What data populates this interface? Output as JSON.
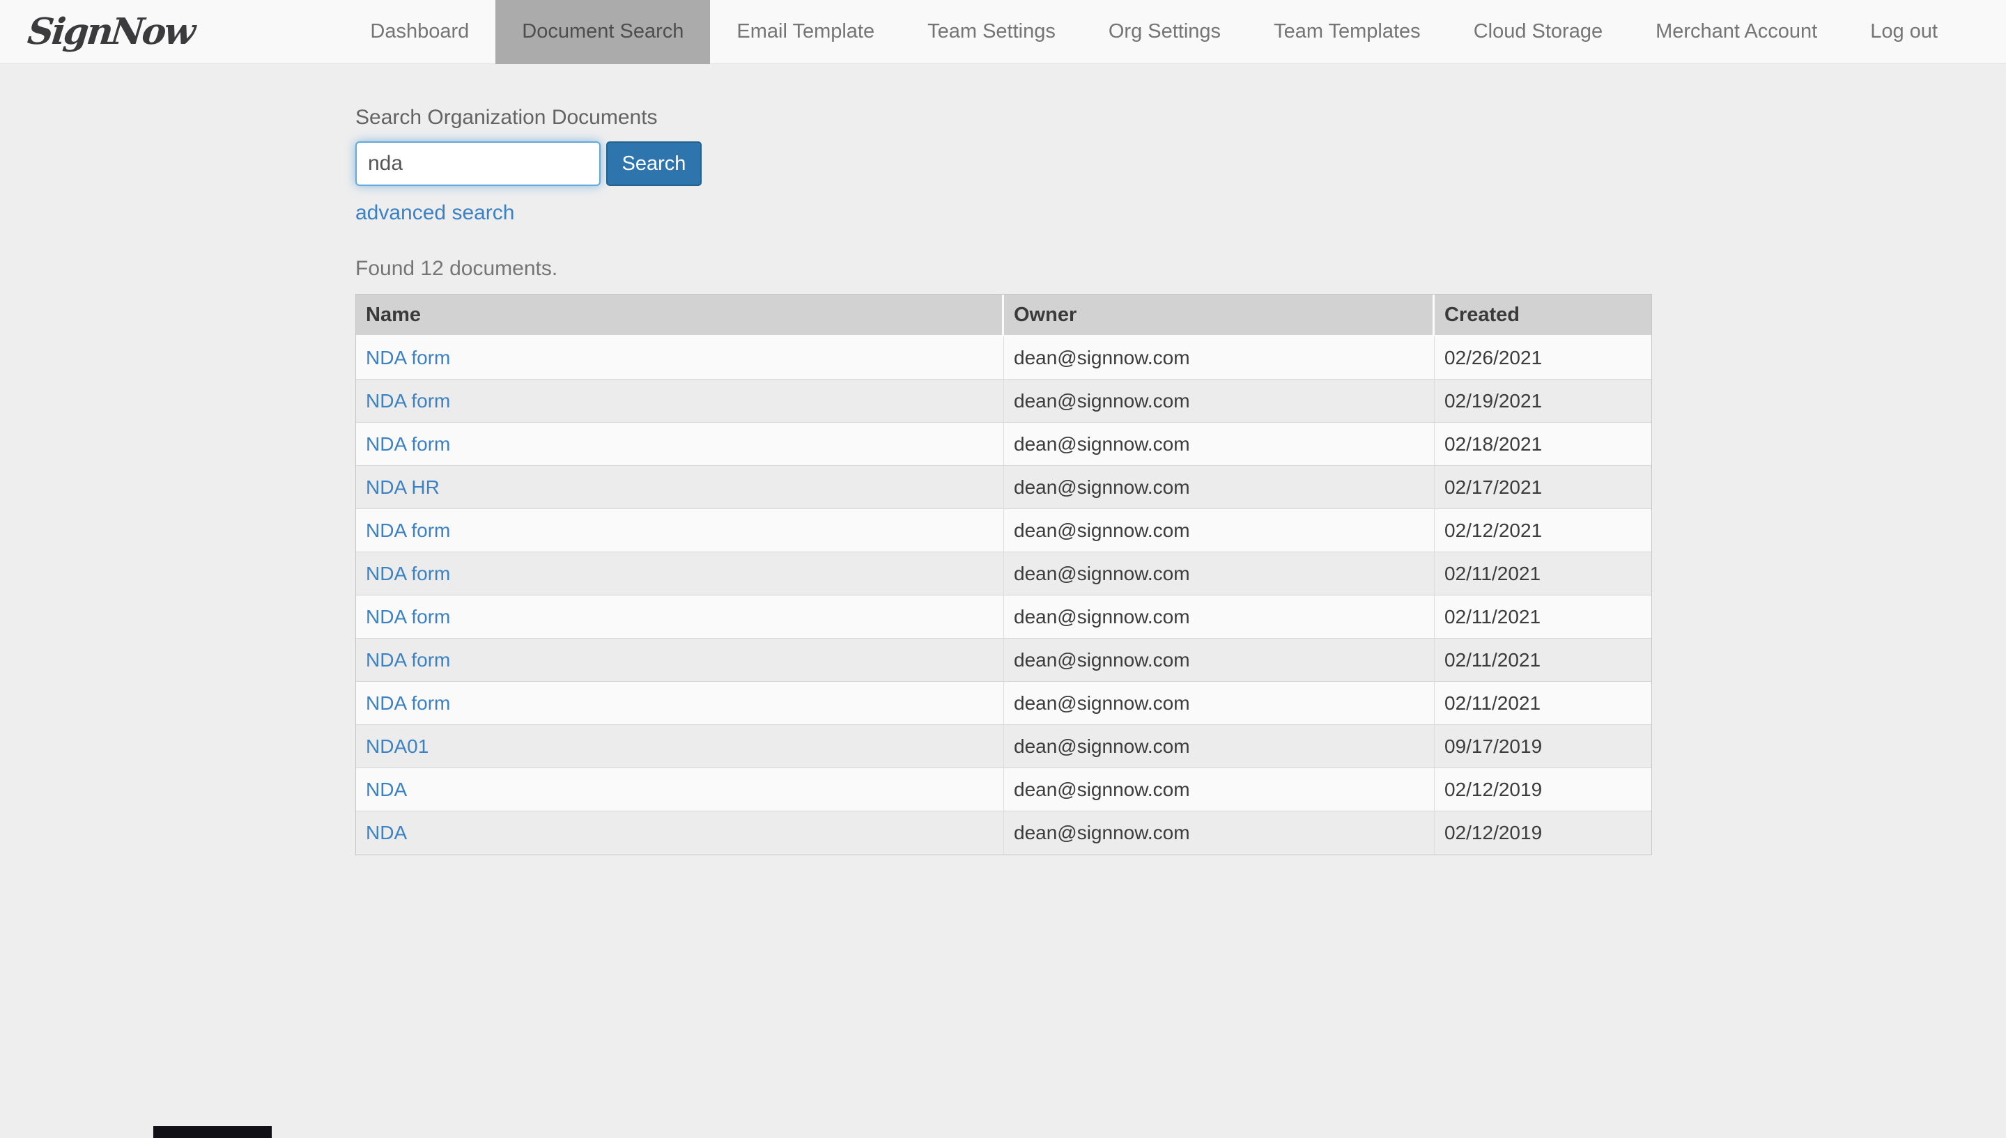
{
  "brand": {
    "logo_text": "SignNow"
  },
  "nav": {
    "items": [
      {
        "label": "Dashboard",
        "active": false
      },
      {
        "label": "Document Search",
        "active": true
      },
      {
        "label": "Email Template",
        "active": false
      },
      {
        "label": "Team Settings",
        "active": false
      },
      {
        "label": "Org Settings",
        "active": false
      },
      {
        "label": "Team Templates",
        "active": false
      },
      {
        "label": "Cloud Storage",
        "active": false
      },
      {
        "label": "Merchant Account",
        "active": false
      },
      {
        "label": "Log out",
        "active": false
      }
    ]
  },
  "search": {
    "section_label": "Search Organization Documents",
    "input_value": "nda",
    "button_label": "Search",
    "advanced_link": "advanced search",
    "result_summary": "Found 12 documents."
  },
  "table": {
    "columns": [
      "Name",
      "Owner",
      "Created"
    ],
    "rows": [
      {
        "name": "NDA form",
        "owner": "dean@signnow.com",
        "created": "02/26/2021"
      },
      {
        "name": "NDA form",
        "owner": "dean@signnow.com",
        "created": "02/19/2021"
      },
      {
        "name": "NDA form",
        "owner": "dean@signnow.com",
        "created": "02/18/2021"
      },
      {
        "name": "NDA HR",
        "owner": "dean@signnow.com",
        "created": "02/17/2021"
      },
      {
        "name": "NDA form",
        "owner": "dean@signnow.com",
        "created": "02/12/2021"
      },
      {
        "name": "NDA form",
        "owner": "dean@signnow.com",
        "created": "02/11/2021"
      },
      {
        "name": "NDA form",
        "owner": "dean@signnow.com",
        "created": "02/11/2021"
      },
      {
        "name": "NDA form",
        "owner": "dean@signnow.com",
        "created": "02/11/2021"
      },
      {
        "name": "NDA form",
        "owner": "dean@signnow.com",
        "created": "02/11/2021"
      },
      {
        "name": "NDA01",
        "owner": "dean@signnow.com",
        "created": "09/17/2019"
      },
      {
        "name": "NDA",
        "owner": "dean@signnow.com",
        "created": "02/12/2019"
      },
      {
        "name": "NDA",
        "owner": "dean@signnow.com",
        "created": "02/12/2019"
      }
    ]
  },
  "colors": {
    "accent_blue": "#2e75ad",
    "link_blue": "#3b82c4",
    "active_tab_gray": "#ababab",
    "table_header_gray": "#d2d2d2",
    "page_background": "#eeeeee"
  }
}
